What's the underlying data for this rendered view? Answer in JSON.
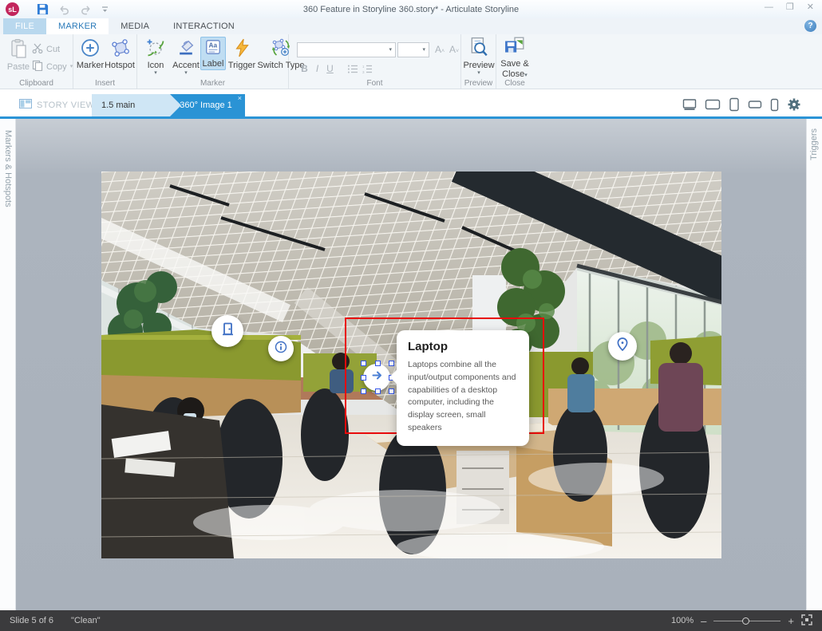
{
  "titlebar": {
    "logo": "sL",
    "title": "360 Feature in Storyline 360.story*  -  Articulate Storyline"
  },
  "menu": {
    "tabs": [
      "FILE",
      "MARKER",
      "MEDIA",
      "INTERACTION"
    ]
  },
  "ribbon": {
    "clipboard": {
      "group": "Clipboard",
      "paste": "Paste",
      "cut": "Cut",
      "copy": "Copy"
    },
    "insert": {
      "group": "Insert",
      "marker": "Marker",
      "hotspot": "Hotspot"
    },
    "marker": {
      "group": "Marker",
      "icon": "Icon",
      "accent": "Accent",
      "label": "Label",
      "trigger": "Trigger",
      "switch_type": "Switch Type"
    },
    "font": {
      "group": "Font",
      "bold": "B",
      "italic": "I",
      "underline": "U"
    },
    "preview": {
      "group": "Preview",
      "button": "Preview"
    },
    "close": {
      "group": "Close",
      "line1": "Save &",
      "line2": "Close"
    }
  },
  "tabstrip": {
    "story_view": "STORY VIEW",
    "scene_tab": "1.5 main",
    "active_tab": "360° Image 1",
    "close_glyph": "×"
  },
  "panels": {
    "left": "Markers & Hotspots",
    "right": "Triggers"
  },
  "canvas": {
    "tooltip": {
      "title": "Laptop",
      "body": "Laptops combine all the input/output components and capabilities of a desktop computer, including the display screen, small speakers"
    },
    "markers": [
      "door",
      "info",
      "arrow",
      "pin"
    ]
  },
  "statusbar": {
    "slide": "Slide 5 of 6",
    "theme": "\"Clean\"",
    "zoom": "100%"
  },
  "colors": {
    "accent_blue": "#2a93d5",
    "selection_red": "#e80b0b",
    "marker_blue": "#3e6fc4",
    "trigger_orange": "#f0a72f",
    "active_menu_text": "#2a7ab9"
  }
}
